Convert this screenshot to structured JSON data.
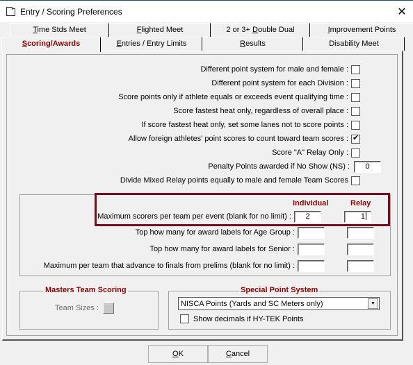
{
  "window": {
    "title": "Entry / Scoring Preferences",
    "close_label": "✕"
  },
  "tabs": {
    "row1": [
      {
        "label_u": "T",
        "label_rest": "ime Stds Meet"
      },
      {
        "label_u": "F",
        "label_rest": "lighted Meet"
      },
      {
        "label_pre": "2 or 3+ ",
        "label_u": "D",
        "label_rest": "ouble Dual"
      },
      {
        "label_u": "I",
        "label_rest": "mprovement Points"
      }
    ],
    "row2": [
      {
        "label_u": "S",
        "label_rest": "coring/Awards",
        "active": true
      },
      {
        "label_u": "E",
        "label_rest": "ntries / Entry Limits"
      },
      {
        "label_u": "R",
        "label_rest": "esults"
      },
      {
        "label_u": "",
        "label_rest": "Disability Meet"
      }
    ]
  },
  "options": [
    {
      "label": "Different point system for male and female :",
      "checked": false
    },
    {
      "label": "Different point system for each Division :",
      "checked": false
    },
    {
      "label": "Score points only if athlete equals or exceeds event qualifying time :",
      "checked": false
    },
    {
      "label": "Score fastest heat only, regardless of overall place :",
      "checked": false
    },
    {
      "label": "If score fastest heat only, set some lanes not to score points :",
      "checked": false
    },
    {
      "label": "Allow foreign athletes' point scores to count toward team scores :",
      "checked": true
    },
    {
      "label": "Score \"A\" Relay Only :",
      "checked": false
    }
  ],
  "penalty": {
    "label": "Penalty Points awarded if No Show (NS) :",
    "value": "0"
  },
  "divide_mixed": {
    "label": "Divide Mixed Relay points equally to male and female Team Scores",
    "checked": false
  },
  "limits": {
    "col_individual": "Individual",
    "col_relay": "Relay",
    "rows": [
      {
        "label": "Maximum scorers per team per event (blank for no limit) :",
        "individual": "2",
        "relay": "1"
      },
      {
        "label": "Top how many for award labels for Age Group :",
        "individual": "",
        "relay": ""
      },
      {
        "label": "Top how many for award labels for Senior :",
        "individual": "",
        "relay": ""
      },
      {
        "label": "Maximum per team that advance to finals from prelims (blank for no limit) :",
        "individual": "",
        "relay": ""
      }
    ]
  },
  "masters": {
    "title": "Masters Team Scoring",
    "team_sizes_label": "Team Sizes :"
  },
  "special_points": {
    "title": "Special Point System",
    "selected": "NISCA Points (Yards and SC Meters only)",
    "show_decimals_label": "Show decimals if HY-TEK Points",
    "show_decimals_checked": false
  },
  "buttons": {
    "ok_u": "O",
    "ok_rest": "K",
    "cancel_u": "C",
    "cancel_rest": "ancel"
  },
  "colors": {
    "accent": "#8b0000",
    "highlight_border": "#7a0b1c"
  }
}
